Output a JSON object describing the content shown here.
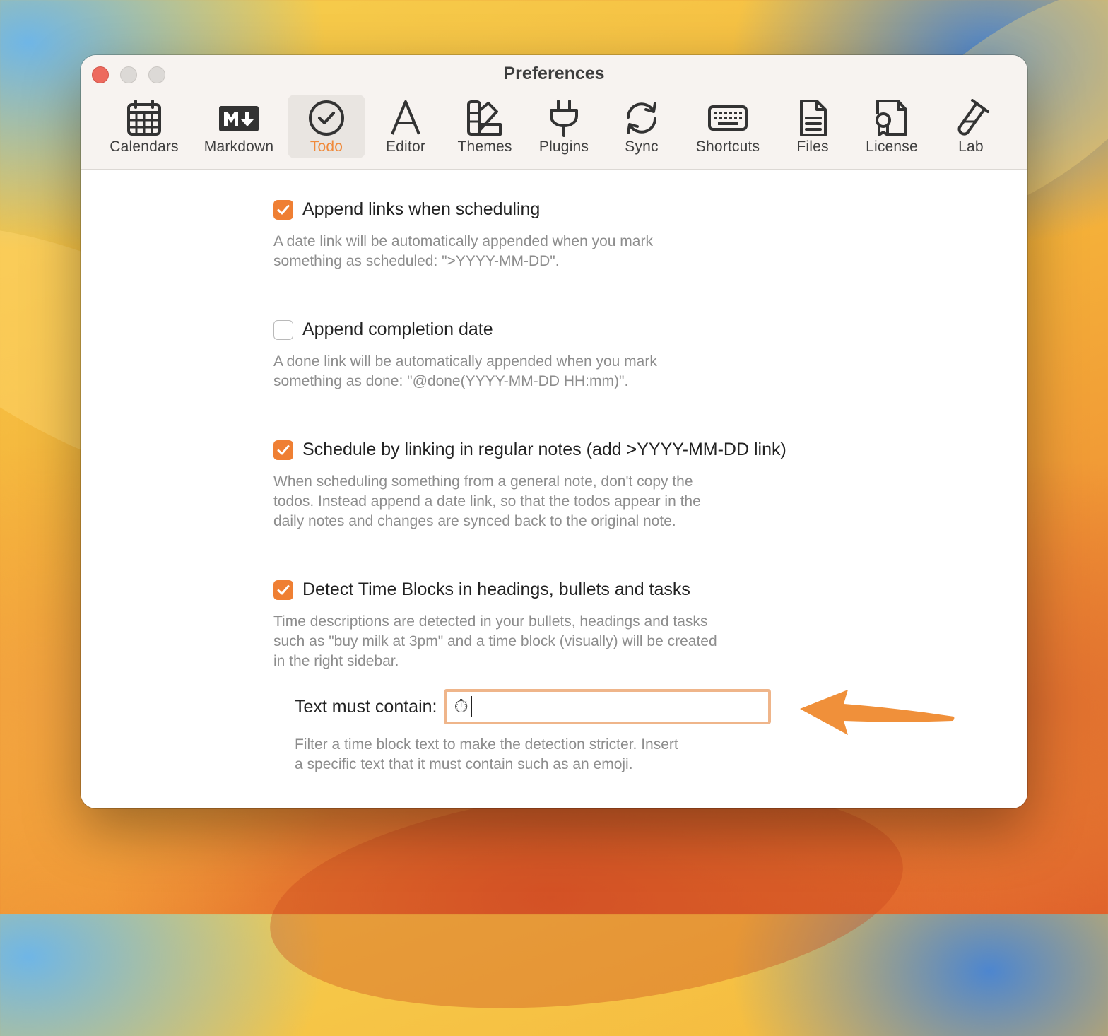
{
  "window": {
    "title": "Preferences"
  },
  "toolbar": {
    "selected": "Todo",
    "accent_color": "#f08a3b",
    "items": [
      {
        "label": "Calendars",
        "icon": "calendar-icon"
      },
      {
        "label": "Markdown",
        "icon": "markdown-icon"
      },
      {
        "label": "Todo",
        "icon": "check-circle-icon"
      },
      {
        "label": "Editor",
        "icon": "letter-a-icon"
      },
      {
        "label": "Themes",
        "icon": "swatches-icon"
      },
      {
        "label": "Plugins",
        "icon": "plug-icon"
      },
      {
        "label": "Sync",
        "icon": "sync-icon"
      },
      {
        "label": "Shortcuts",
        "icon": "keyboard-icon"
      },
      {
        "label": "Files",
        "icon": "file-icon"
      },
      {
        "label": "License",
        "icon": "certificate-icon"
      },
      {
        "label": "Lab",
        "icon": "test-tube-icon"
      }
    ]
  },
  "options": [
    {
      "label": "Append links when scheduling",
      "checked": true,
      "description": "A date link will be automatically appended when you mark\nsomething as scheduled: \">YYYY-MM-DD\"."
    },
    {
      "label": "Append completion date",
      "checked": false,
      "description": "A done link will be automatically appended when you mark\nsomething as done: \"@done(YYYY-MM-DD HH:mm)\"."
    },
    {
      "label": "Schedule by linking in regular notes (add >YYYY-MM-DD link)",
      "checked": true,
      "description": "When scheduling something from a general note, don't copy the\ntodos. Instead append a date link, so that the todos appear in the\ndaily notes and changes are synced back to the original note."
    },
    {
      "label": "Detect Time Blocks in headings, bullets and tasks",
      "checked": true,
      "description": "Time descriptions are detected in your bullets, headings and tasks\nsuch as \"buy milk at 3pm\" and a time block (visually) will be created\nin the right sidebar."
    }
  ],
  "time_block_filter": {
    "label": "Text must contain:",
    "value": "⏱",
    "description": "Filter a time block text to make the detection stricter. Insert\na specific text that it must contain such as an emoji."
  },
  "colors": {
    "checkbox_on": "#ef7f33",
    "field_focus_ring": "#efb58a",
    "annotation_arrow": "#f0903a"
  }
}
